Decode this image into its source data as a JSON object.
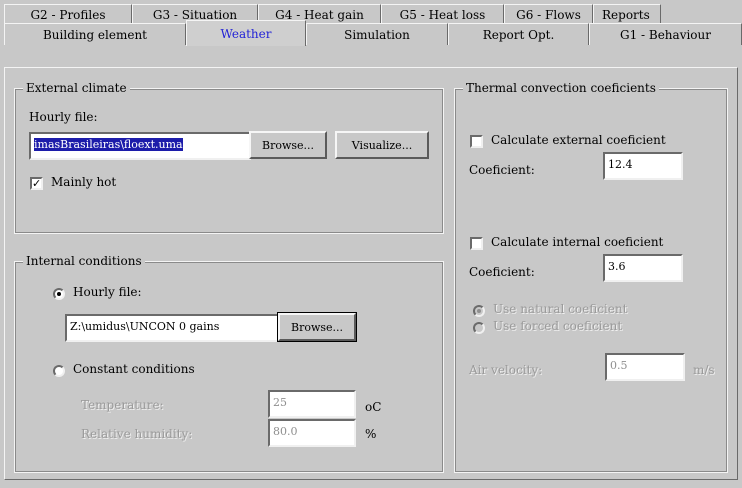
{
  "tabs_row1": [
    "G2 - Profiles",
    "G3 - Situation",
    "G4 - Heat gain",
    "G5 - Heat loss",
    "G6 - Flows",
    "Reports"
  ],
  "tabs_row2": [
    "Building element",
    "Weather",
    "Simulation",
    "Report Opt.",
    "G1 - Behaviour"
  ],
  "external_climate": {
    "title": "External climate",
    "hourly_file_label": "Hourly file:",
    "hourly_file_value": "imasBrasileiras\\floext.uma",
    "browse_label": "Browse...",
    "visualize_label": "Visualize...",
    "mainly_hot_label": "Mainly hot",
    "mainly_hot_checked": true
  },
  "internal_conditions": {
    "title": "Internal conditions",
    "hourly_file_label": "Hourly file:",
    "hourly_file_value": "Z:\\umidus\\UNCON 0 gains",
    "browse_label": "Browse...",
    "constant_label": "Constant conditions",
    "temperature_label": "Temperature:",
    "temperature_value": "25",
    "temperature_unit": "oC",
    "humidity_label": "Relative humidity:",
    "humidity_value": "80.0",
    "humidity_unit": "%"
  },
  "thermal": {
    "title": "Thermal convection coeficients",
    "calc_external_label": "Calculate external coeficient",
    "coef_label_ext": "Coeficient:",
    "coef_external_value": "12.4",
    "calc_internal_label": "Calculate internal coeficient",
    "coef_label_int": "Coeficient:",
    "coef_internal_value": "3.6",
    "use_natural_label": "Use natural coeficient",
    "use_forced_label": "Use forced coeficient",
    "air_velocity_label": "Air velocity:",
    "air_velocity_value": "0.5",
    "air_velocity_unit": "m/s"
  }
}
